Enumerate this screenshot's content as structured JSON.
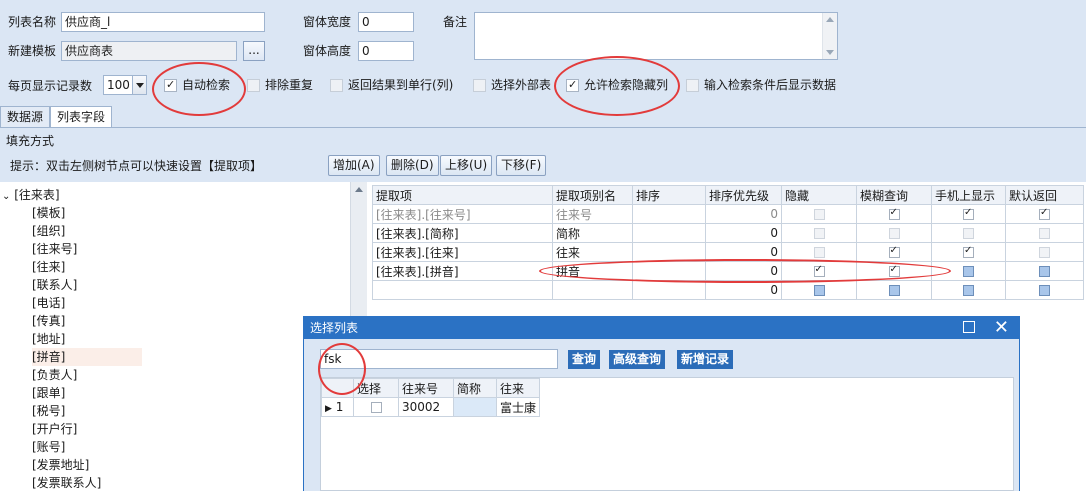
{
  "form": {
    "list_name_label": "列表名称",
    "list_name_value": "供应商_l",
    "template_label": "新建模板",
    "template_value": "供应商表",
    "browse_button": "...",
    "window_width_label": "窗体宽度",
    "window_width_value": "0",
    "window_height_label": "窗体高度",
    "window_height_value": "0",
    "remark_label": "备注",
    "page_size_label": "每页显示记录数",
    "page_size_value": "100"
  },
  "options": [
    {
      "label": "自动检索",
      "checked": true,
      "enabled": true
    },
    {
      "label": "排除重复",
      "checked": false,
      "enabled": false
    },
    {
      "label": "返回结果到单行(列)",
      "checked": false,
      "enabled": false
    },
    {
      "label": "选择外部表",
      "checked": false,
      "enabled": false
    },
    {
      "label": "允许检索隐藏列",
      "checked": true,
      "enabled": true
    },
    {
      "label": "输入检索条件后显示数据",
      "checked": false,
      "enabled": false
    }
  ],
  "tabs": [
    "数据源",
    "列表字段"
  ],
  "section_title": "填充方式",
  "hint": "提示：双击左侧树节点可以快速设置【提取项】",
  "actions": {
    "add": "增加(A)",
    "delete": "删除(D)",
    "up": "上移(U)",
    "down": "下移(F)"
  },
  "tree": {
    "root": "[往来表]",
    "items": [
      "[模板]",
      "[组织]",
      "[往来号]",
      "[往来]",
      "[联系人]",
      "[电话]",
      "[传真]",
      "[地址]",
      "[拼音]",
      "[负责人]",
      "[跟单]",
      "[税号]",
      "[开户行]",
      "[账号]",
      "[发票地址]",
      "[发票联系人]"
    ],
    "selected_index": 8
  },
  "grid": {
    "columns": [
      "提取项",
      "提取项别名",
      "排序",
      "排序优先级",
      "隐藏",
      "模糊查询",
      "手机上显示",
      "默认返回"
    ],
    "rows": [
      {
        "item": "[往来表].[往来号]",
        "alias": "往来号",
        "sort": "",
        "priority": "0",
        "hidden": "dis",
        "fuzzy": "on",
        "mobile": "on",
        "default": "on",
        "dim": true
      },
      {
        "item": "[往来表].[简称]",
        "alias": "简称",
        "sort": "",
        "priority": "0",
        "hidden": "dis",
        "fuzzy": "dis",
        "mobile": "dis",
        "default": "dis",
        "dim": false
      },
      {
        "item": "[往来表].[往来]",
        "alias": "往来",
        "sort": "",
        "priority": "0",
        "hidden": "dis",
        "fuzzy": "on",
        "mobile": "on",
        "default": "dis",
        "dim": false
      },
      {
        "item": "[往来表].[拼音]",
        "alias": "拼音",
        "sort": "",
        "priority": "0",
        "hidden": "on",
        "fuzzy": "on",
        "mobile": "blue",
        "default": "blue",
        "dim": false
      },
      {
        "item": "",
        "alias": "",
        "sort": "",
        "priority": "0",
        "hidden": "blue",
        "fuzzy": "blue",
        "mobile": "blue",
        "default": "blue",
        "dim": false
      }
    ]
  },
  "dialog": {
    "title": "选择列表",
    "search_value": "fsk",
    "buttons": {
      "query": "查询",
      "advanced": "高级查询",
      "new_record": "新增记录"
    },
    "columns": [
      "选择",
      "往来号",
      "简称",
      "往来"
    ],
    "rows": [
      {
        "index": "1",
        "selected": false,
        "code": "30002",
        "short": "",
        "name": "富士康"
      }
    ]
  }
}
